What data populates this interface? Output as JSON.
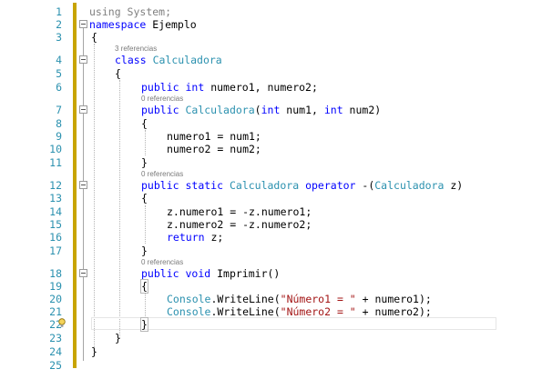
{
  "line_numbers": [
    "1",
    "2",
    "3",
    "4",
    "5",
    "6",
    "7",
    "8",
    "9",
    "10",
    "11",
    "12",
    "13",
    "14",
    "15",
    "16",
    "17",
    "18",
    "19",
    "20",
    "21",
    "22",
    "23",
    "24",
    "25"
  ],
  "codelens": {
    "class_refs": "3 referencias",
    "ctor_refs": "0 referencias",
    "operator_refs": "0 referencias",
    "imprimir_refs": "0 referencias"
  },
  "code": {
    "l1": {
      "kw": "using",
      "rest": " System;"
    },
    "l2": {
      "kw": "namespace",
      "rest": " Ejemplo"
    },
    "l3": "{",
    "l4": {
      "kw": "class",
      "type": "Calculadora"
    },
    "l5": "{",
    "l6": {
      "kw1": "public",
      "kw2": "int",
      "rest": " numero1, numero2;"
    },
    "l7": {
      "kw": "public",
      "type": "Calculadora",
      "p1": "(",
      "kw2": "int",
      "p2": " num1, ",
      "kw3": "int",
      "p3": " num2)"
    },
    "l8": "{",
    "l9": "numero1 = num1;",
    "l10": "numero2 = num2;",
    "l11": "}",
    "l12": {
      "kw1": "public",
      "kw2": "static",
      "type": "Calculadora",
      "kw3": "operator",
      "p1": " -(",
      "type2": "Calculadora",
      "p2": " z)"
    },
    "l13": "{",
    "l14": "z.numero1 = -z.numero1;",
    "l15": "z.numero2 = -z.numero2;",
    "l16": {
      "kw": "return",
      "rest": " z;"
    },
    "l17": "}",
    "l18": {
      "kw1": "public",
      "kw2": "void",
      "rest": " Imprimir()"
    },
    "l19": "{",
    "l20": {
      "type": "Console",
      "p1": ".WriteLine(",
      "str": "\"Número1 = \"",
      "p2": " + numero1);"
    },
    "l21": {
      "type": "Console",
      "p1": ".WriteLine(",
      "str": "\"Número2 = \"",
      "p2": " + numero2);"
    },
    "l22": "}",
    "l23": "}",
    "l24": "}"
  },
  "icons": {
    "lightbulb": "lightbulb-icon",
    "fold": "collapse-minus-icon"
  },
  "colors": {
    "keyword": "#0000ff",
    "type": "#2b91af",
    "string": "#a31515",
    "line_number": "#2b91af",
    "modified_bar": "#c8a400"
  }
}
